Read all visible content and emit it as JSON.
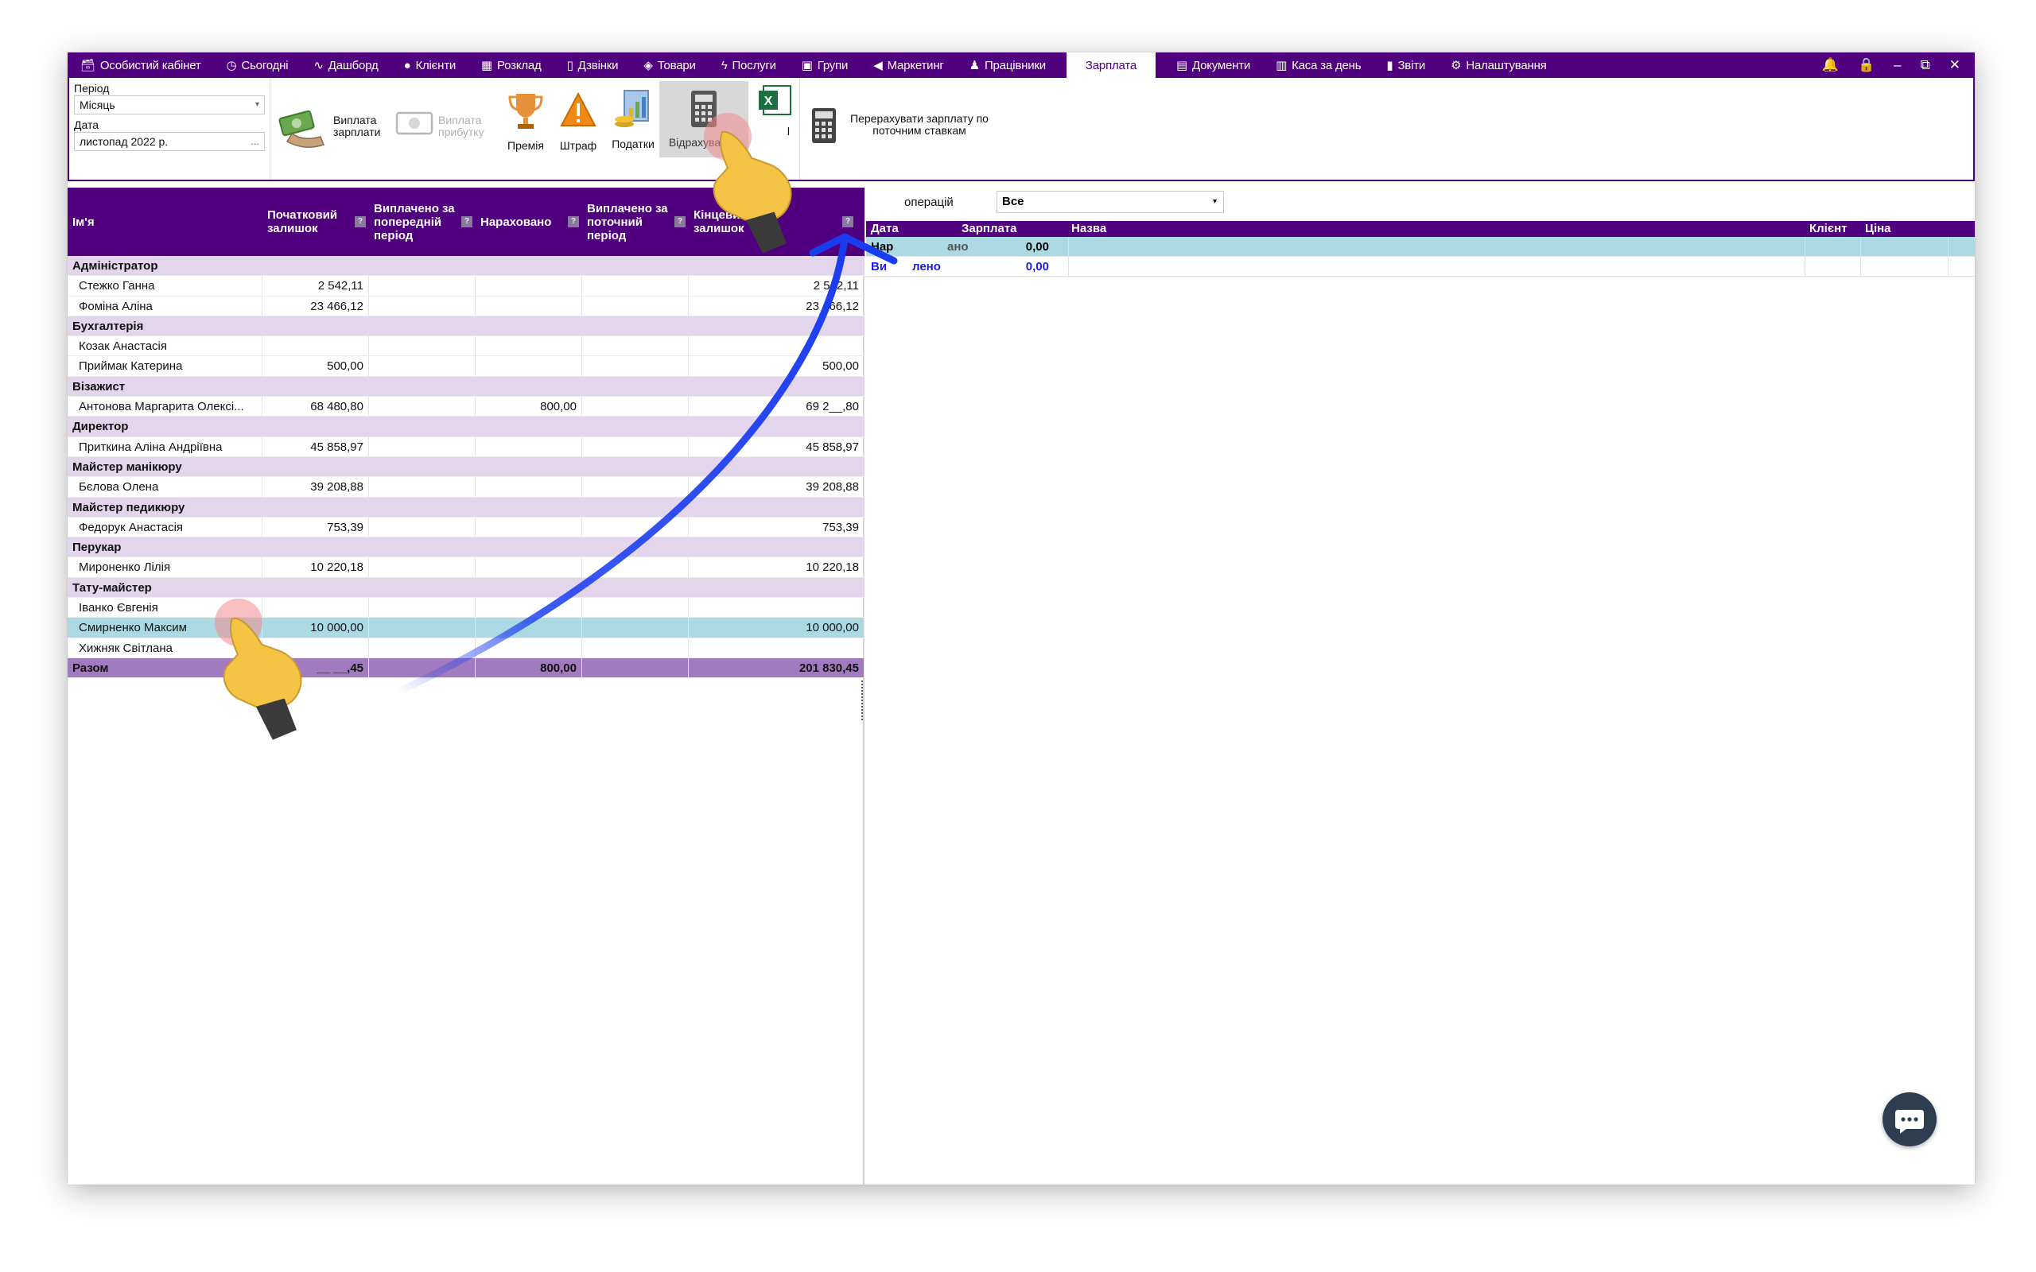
{
  "nav": {
    "items": [
      {
        "label": "Особистий кабінет",
        "icon": "person-card-icon"
      },
      {
        "label": "Сьогодні",
        "icon": "clock-icon"
      },
      {
        "label": "Дашборд",
        "icon": "pulse-icon"
      },
      {
        "label": "Клієнти",
        "icon": "user-circle-icon"
      },
      {
        "label": "Розклад",
        "icon": "calendar-icon"
      },
      {
        "label": "Дзвінки",
        "icon": "phone-icon"
      },
      {
        "label": "Товари",
        "icon": "box-icon"
      },
      {
        "label": "Послуги",
        "icon": "lightning-icon"
      },
      {
        "label": "Групи",
        "icon": "group-icon"
      },
      {
        "label": "Маркетинг",
        "icon": "megaphone-icon"
      },
      {
        "label": "Працівники",
        "icon": "person-icon"
      }
    ],
    "active": "Зарплата",
    "items_after": [
      {
        "label": "Документи",
        "icon": "document-icon"
      },
      {
        "label": "Каса за день",
        "icon": "calculator-icon"
      },
      {
        "label": "Звіти",
        "icon": "bar-chart-icon"
      },
      {
        "label": "Налаштування",
        "icon": "gear-icon"
      }
    ],
    "controls": {
      "bell": "🔔",
      "lock": "🔒",
      "minimize": "–",
      "restore": "⧉",
      "close": "✕"
    }
  },
  "filters": {
    "period_label": "Період",
    "period_value": "Місяць",
    "date_label": "Дата",
    "date_value": "листопад 2022 р.",
    "date_button": "..."
  },
  "toolbar": {
    "pay_salary": "Виплата зарплати",
    "pay_profit": "Виплата прибутку",
    "bonus": "Премія",
    "fine": "Штраф",
    "taxes": "Податки",
    "deductions": "Відрахування",
    "excel_tail": "l",
    "recalc": "Перерахувати зарплату по поточним ставкам"
  },
  "grid": {
    "headers": {
      "name": "Ім'я",
      "start": "Початковий залишок",
      "paid_prev": "Виплачено за попередній період",
      "accrued": "Нараховано",
      "paid_cur": "Виплачено за поточний період",
      "end": "Кінцевий залишок",
      "help": "?"
    },
    "rows": [
      {
        "type": "group",
        "name": "Адміністратор"
      },
      {
        "type": "item",
        "name": "Стежко Ганна",
        "start": "2 542,11",
        "paid_prev": "",
        "accrued": "",
        "paid_cur": "",
        "end": "2 542,11"
      },
      {
        "type": "item",
        "name": "Фоміна Аліна",
        "start": "23 466,12",
        "paid_prev": "",
        "accrued": "",
        "paid_cur": "",
        "end": "23 466,12"
      },
      {
        "type": "group",
        "name": "Бухгалтерія"
      },
      {
        "type": "item",
        "name": "Козак Анастасія",
        "start": "",
        "paid_prev": "",
        "accrued": "",
        "paid_cur": "",
        "end": ""
      },
      {
        "type": "item",
        "name": "Приймак Катерина",
        "start": "500,00",
        "paid_prev": "",
        "accrued": "",
        "paid_cur": "",
        "end": "500,00"
      },
      {
        "type": "group",
        "name": "Візажист"
      },
      {
        "type": "item",
        "name": "Антонова Маргарита Олексі...",
        "start": "68 480,80",
        "paid_prev": "",
        "accrued": "800,00",
        "paid_cur": "",
        "end": "69 2__,80"
      },
      {
        "type": "group",
        "name": "Директор"
      },
      {
        "type": "item",
        "name": "Приткина Аліна Андріївна",
        "start": "45 858,97",
        "paid_prev": "",
        "accrued": "",
        "paid_cur": "",
        "end": "45 858,97"
      },
      {
        "type": "group",
        "name": "Майстер манікюру"
      },
      {
        "type": "item",
        "name": "Бєлова Олена",
        "start": "39 208,88",
        "paid_prev": "",
        "accrued": "",
        "paid_cur": "",
        "end": "39 208,88"
      },
      {
        "type": "group",
        "name": "Майстер педикюру"
      },
      {
        "type": "item",
        "name": "Федорук Анастасія",
        "start": "753,39",
        "paid_prev": "",
        "accrued": "",
        "paid_cur": "",
        "end": "753,39"
      },
      {
        "type": "group",
        "name": "Перукар"
      },
      {
        "type": "item",
        "name": "Мироненко Лілія",
        "start": "10 220,18",
        "paid_prev": "",
        "accrued": "",
        "paid_cur": "",
        "end": "10 220,18"
      },
      {
        "type": "group",
        "name": "Тату-майстер"
      },
      {
        "type": "item",
        "name": "Іванко Євгенія",
        "start": "",
        "paid_prev": "",
        "accrued": "",
        "paid_cur": "",
        "end": ""
      },
      {
        "type": "sel",
        "name": "Смирненко Максим",
        "start": "10 000,00",
        "paid_prev": "",
        "accrued": "",
        "paid_cur": "",
        "end": "10 000,00"
      },
      {
        "type": "item",
        "name": "Хижняк Світлана",
        "start": "",
        "paid_prev": "",
        "accrued": "",
        "paid_cur": "",
        "end": ""
      },
      {
        "type": "total",
        "name": "Разом",
        "start": "__ __,45",
        "paid_prev": "",
        "accrued": "800,00",
        "paid_cur": "",
        "end": "201 830,45"
      }
    ]
  },
  "details": {
    "op_label": "операцій",
    "op_value": "Все",
    "headers": {
      "date": "Дата",
      "salary": "Зарплата",
      "name": "Назва",
      "client": "Клієнт",
      "price": "Ціна"
    },
    "rows": [
      {
        "label": "Нар",
        "label_tail": "ано",
        "value": "0,00",
        "color": "#111111"
      },
      {
        "label": "Ви",
        "label_tail": "лено",
        "value": "0,00",
        "color": "#1a1aee"
      }
    ]
  },
  "colors": {
    "nav_bg": "#50007f",
    "group_row": "#e2d5ec",
    "selected_row": "#abd9e4",
    "total_row": "#a27abf",
    "annotation_arrow": "#1a3cf0"
  }
}
